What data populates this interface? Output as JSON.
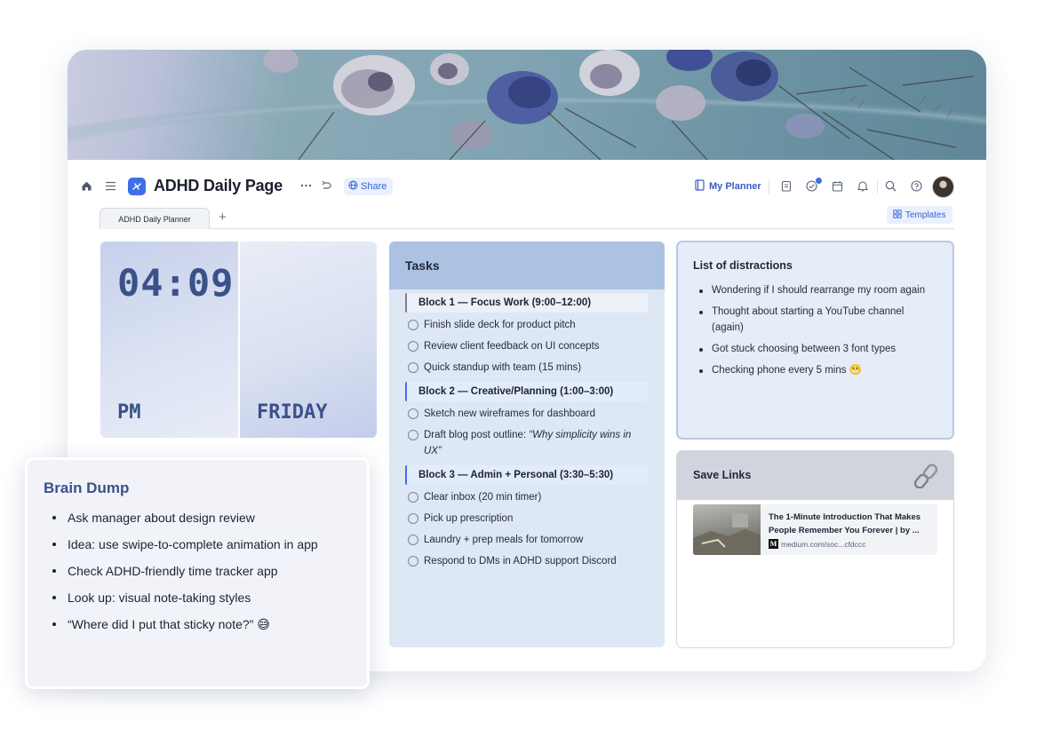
{
  "header": {
    "page_title": "ADHD Daily Page",
    "share_label": "Share",
    "my_planner_label": "My Planner"
  },
  "tabs": {
    "active_tab": "ADHD Daily Planner",
    "add_tab": "+",
    "templates_label": "Templates"
  },
  "clock": {
    "time": "04:09",
    "ampm": "PM",
    "day": "FRIDAY"
  },
  "tasks": {
    "title": "Tasks",
    "blocks": [
      {
        "label": "Block 1 — Focus Work (9:00–12:00)",
        "items": [
          "Finish slide deck for product pitch",
          "Review client feedback on UI concepts",
          "Quick standup with team (15 mins)"
        ]
      },
      {
        "label": "Block 2 — Creative/Planning (1:00–3:00)",
        "items": [
          "Sketch new wireframes for dashboard"
        ],
        "blog_item_prefix": "Draft blog post outline: ",
        "blog_item_italic": "“Why simplicity wins in UX”"
      },
      {
        "label": "Block 3 — Admin + Personal (3:30–5:30)",
        "items": [
          "Clear inbox (20 min timer)",
          "Pick up prescription",
          "Laundry + prep meals for tomorrow",
          "Respond to DMs in ADHD support Discord"
        ]
      }
    ]
  },
  "distractions": {
    "title": "List of distractions",
    "items": [
      "Wondering if I should rearrange my room again",
      "Thought about starting a YouTube channel (again)",
      "Got stuck choosing between 3 font types",
      "Checking phone every 5 mins 😬"
    ]
  },
  "save_links": {
    "title": "Save Links",
    "link_title": "The 1-Minute Introduction That Makes People Remember You Forever | by ...",
    "link_source": "medium.com/soc...cfdccc",
    "source_logo": "M"
  },
  "brain_dump": {
    "title": "Brain Dump",
    "items": [
      "Ask manager about design review",
      "Idea: use swipe-to-complete animation in app",
      "Check ADHD-friendly time tracker app",
      "Look up: visual note-taking styles",
      "“Where did I put that sticky note?” 😅"
    ]
  },
  "icons": {
    "home": "home-icon",
    "menu": "menu-icon",
    "more": "more-icon",
    "undo": "undo-icon",
    "globe": "globe-icon",
    "book": "book-icon",
    "clipboard": "clipboard-icon",
    "check": "check-circle-icon",
    "calendar": "calendar-icon",
    "bell": "bell-icon",
    "search": "search-icon",
    "help": "help-icon",
    "templates": "grid-icon",
    "link": "chain-link-icon"
  },
  "colors": {
    "accent": "#3f6ee8",
    "clock_text": "#3b5189",
    "tasks_header": "#acc2e2",
    "tasks_bg": "#dee7f4",
    "distractions_bg": "#e6edf8",
    "savelinks_header": "#d0d4dd",
    "braindump_title": "#3b5189"
  }
}
